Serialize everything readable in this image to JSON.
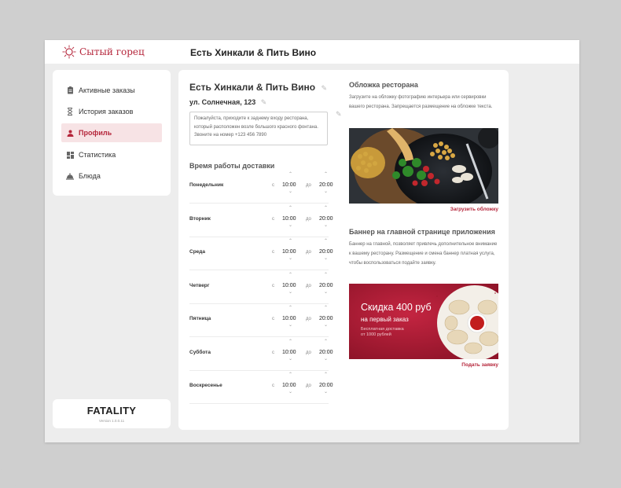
{
  "app": {
    "logo_text": "Сытый горец",
    "page_title": "Есть Хинкали & Пить Вино"
  },
  "sidebar": {
    "items": [
      {
        "label": "Активные заказы",
        "icon": "clipboard-icon",
        "active": false
      },
      {
        "label": "История заказов",
        "icon": "hourglass-icon",
        "active": false
      },
      {
        "label": "Профиль",
        "icon": "person-icon",
        "active": true
      },
      {
        "label": "Статистика",
        "icon": "dashboard-icon",
        "active": false
      },
      {
        "label": "Блюда",
        "icon": "cloche-icon",
        "active": false
      }
    ]
  },
  "brand": {
    "name": "FATALITY",
    "version": "Version 1.0.0.11"
  },
  "restaurant": {
    "name": "Есть Хинкали & Пить Вино",
    "address": "ул. Солнечная, 123",
    "note": "Пожалуйста, приходите к заднему входу ресторана, который расположен возле большого красного фонтана. Звоните на номер +123 456 7890"
  },
  "delivery_hours": {
    "title": "Время работы доставки",
    "from_label": "с",
    "to_label": "до",
    "days": [
      {
        "day": "Понедельник",
        "from": "10:00",
        "to": "20:00"
      },
      {
        "day": "Вторник",
        "from": "10:00",
        "to": "20:00"
      },
      {
        "day": "Среда",
        "from": "10:00",
        "to": "20:00"
      },
      {
        "day": "Четверг",
        "from": "10:00",
        "to": "20:00"
      },
      {
        "day": "Пятница",
        "from": "10:00",
        "to": "20:00"
      },
      {
        "day": "Суббота",
        "from": "10:00",
        "to": "20:00"
      },
      {
        "day": "Воскресенье",
        "from": "10:00",
        "to": "20:00"
      }
    ]
  },
  "cover": {
    "title": "Обложка ресторана",
    "description": "Загрузите на обложку фотографию интерьера или сервировки вашего ресторана. Запрещается размещение на обложке текста.",
    "upload_label": "Загрузить обложку"
  },
  "banner": {
    "title": "Баннер на главной странице приложения",
    "description": "Баннер на главной, позволяет привлечь дополнительное внимание к вашему ресторану. Размещение и смена баннер платная услуга, чтобы воспользоваться подайте заявку.",
    "headline": "Скидка 400 руб",
    "subheadline": "на первый заказ",
    "small_line1": "Бесплатная доставка",
    "small_line2": "от 1000 рублей",
    "apply_label": "Подать заявку"
  },
  "colors": {
    "accent": "#b5263b",
    "banner_bg": "#b31e37",
    "active_bg": "#f7e3e5"
  }
}
